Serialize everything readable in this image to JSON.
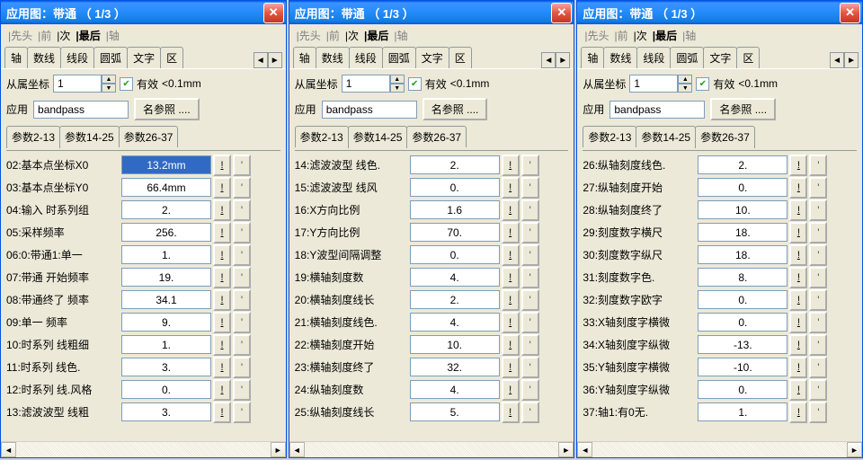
{
  "title": "应用图：带通    （ 1/3 ）",
  "nav": {
    "first": "先头",
    "prev": "前",
    "next": "次",
    "last": "最后",
    "axis": "轴"
  },
  "tabs": [
    "轴",
    "数线",
    "线段",
    "圆弧",
    "文字",
    "区"
  ],
  "row1": {
    "label": "从属坐标",
    "value": "1",
    "check_label": "有效",
    "extra": "<0.1mm"
  },
  "row2": {
    "apply": "应用",
    "value": "bandpass",
    "ref_btn": "名参照 ...."
  },
  "ptabs": [
    "参数2-13",
    "参数14-25",
    "参数26-37"
  ],
  "panes": [
    {
      "active": 0,
      "rows": [
        {
          "n": "02",
          "l": "基本点坐标X0",
          "v": "13.2mm",
          "sel": true
        },
        {
          "n": "03",
          "l": "基本点坐标Y0",
          "v": "66.4mm"
        },
        {
          "n": "04",
          "l": "输入 时系列组",
          "v": "2."
        },
        {
          "n": "05",
          "l": "采样频率",
          "v": "256."
        },
        {
          "n": "06",
          "l": "0:带通1:单一",
          "v": "1."
        },
        {
          "n": "07",
          "l": "带通 开始频率",
          "v": "19."
        },
        {
          "n": "08",
          "l": "带通终了 频率",
          "v": "34.1"
        },
        {
          "n": "09",
          "l": "单一 频率",
          "v": "9."
        },
        {
          "n": "10",
          "l": "时系列 线粗细",
          "v": "1."
        },
        {
          "n": "11",
          "l": "时系列 线色.",
          "v": "3."
        },
        {
          "n": "12",
          "l": "时系列 线.风格",
          "v": "0."
        },
        {
          "n": "13",
          "l": "滤波波型 线粗",
          "v": "3."
        }
      ]
    },
    {
      "active": 1,
      "rows": [
        {
          "n": "14",
          "l": "滤波波型 线色.",
          "v": "2."
        },
        {
          "n": "15",
          "l": "滤波波型 线风",
          "v": "0."
        },
        {
          "n": "16",
          "l": "X方向比例",
          "v": "1.6"
        },
        {
          "n": "17",
          "l": "Y方向比例",
          "v": "70."
        },
        {
          "n": "18",
          "l": "Y波型间隔调整",
          "v": "0."
        },
        {
          "n": "19",
          "l": "横轴刻度数",
          "v": "4."
        },
        {
          "n": "20",
          "l": "横轴刻度线长",
          "v": "2."
        },
        {
          "n": "21",
          "l": "横轴刻度线色.",
          "v": "4."
        },
        {
          "n": "22",
          "l": "横轴刻度开始",
          "v": "10."
        },
        {
          "n": "23",
          "l": "横轴刻度终了",
          "v": "32."
        },
        {
          "n": "24",
          "l": "纵轴刻度数",
          "v": "4."
        },
        {
          "n": "25",
          "l": "纵轴刻度线长",
          "v": "5."
        }
      ]
    },
    {
      "active": 2,
      "rows": [
        {
          "n": "26",
          "l": "纵轴刻度线色.",
          "v": "2."
        },
        {
          "n": "27",
          "l": "纵轴刻度开始",
          "v": "0."
        },
        {
          "n": "28",
          "l": "纵轴刻度终了",
          "v": "10."
        },
        {
          "n": "29",
          "l": "刻度数字横尺",
          "v": "18."
        },
        {
          "n": "30",
          "l": "刻度数字纵尺",
          "v": "18."
        },
        {
          "n": "31",
          "l": "刻度数字色.",
          "v": "8."
        },
        {
          "n": "32",
          "l": "刻度数字欧字",
          "v": "0."
        },
        {
          "n": "33",
          "l": "X轴刻度字横微",
          "v": "0."
        },
        {
          "n": "34",
          "l": "X轴刻度字纵微",
          "v": "-13."
        },
        {
          "n": "35",
          "l": "Y轴刻度字横微",
          "v": "-10."
        },
        {
          "n": "36",
          "l": "Y轴刻度字纵微",
          "v": "0."
        },
        {
          "n": "37",
          "l": "轴1:有0无.",
          "v": "1."
        }
      ]
    }
  ]
}
